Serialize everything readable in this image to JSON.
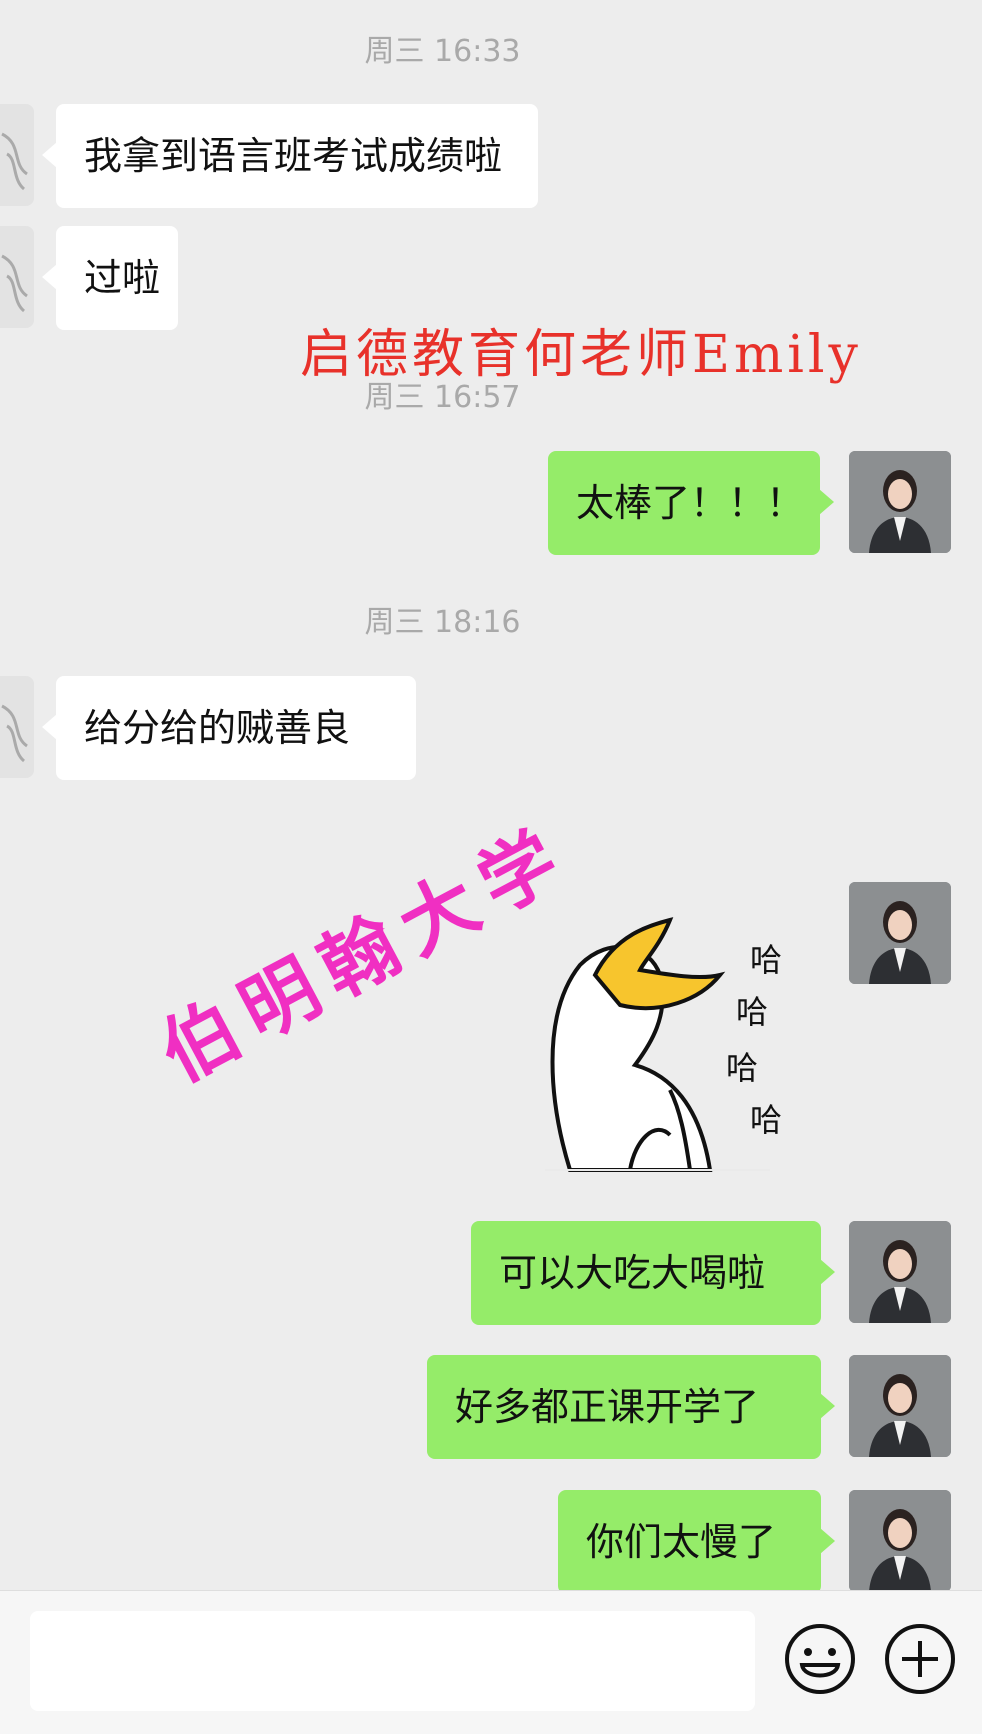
{
  "chat": {
    "timestamps": [
      "周三 16:33",
      "周三 16:57",
      "周三 18:16"
    ],
    "messages": {
      "m1": "我拿到语言班考试成绩啦",
      "m2": "过啦",
      "m3": "太棒了！！！",
      "m4": "给分给的贼善良",
      "m5": "可以大吃大喝啦",
      "m6": "好多都正课开学了",
      "m7": "你们太慢了"
    },
    "sticker": {
      "text1": "哈",
      "text2": "哈",
      "text3": "哈",
      "text4": "哈"
    }
  },
  "watermarks": {
    "top": "启德教育何老师Emily",
    "middle": "伯明翰大学"
  },
  "input_bar": {
    "emoji_icon": "smiley-icon",
    "add_icon": "plus-circle-icon"
  },
  "colors": {
    "background": "#ededed",
    "incoming_bubble": "#ffffff",
    "outgoing_bubble": "#95ec69",
    "watermark_red": "#e8312a",
    "watermark_pink": "#f02fc2"
  }
}
